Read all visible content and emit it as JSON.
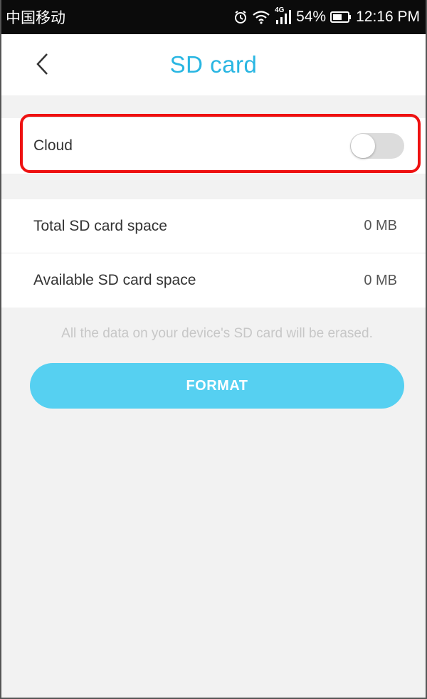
{
  "status_bar": {
    "carrier": "中国移动",
    "network_tag": "4G",
    "battery_percent": "54%",
    "time": "12:16 PM",
    "icons": [
      "alarm-icon",
      "wifi-icon",
      "signal-icon",
      "battery-icon"
    ]
  },
  "header": {
    "title": "SD card",
    "back_icon": "chevron-left-icon"
  },
  "cloud": {
    "label": "Cloud",
    "enabled": false
  },
  "storage": {
    "rows": [
      {
        "label": "Total SD card space",
        "value": "0 MB"
      },
      {
        "label": "Available SD card space",
        "value": "0 MB"
      }
    ]
  },
  "warning": "All the data on your device's SD card will be erased.",
  "format_button": "FORMAT",
  "colors": {
    "accent": "#29b6e2",
    "button": "#56d0f1",
    "highlight": "#ee1111"
  }
}
